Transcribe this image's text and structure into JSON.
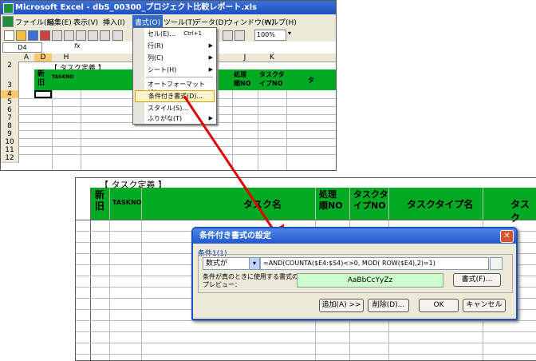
{
  "top_window": {
    "title": "Microsoft Excel - dbS_00300_プロジェクト比較レポート.xls",
    "menu": [
      "ファイル(F)",
      "編集(E)",
      "表示(V)",
      "挿入(I)",
      "書式(O)",
      "ツール(T)",
      "データ(D)",
      "ウィンドウ(W)",
      "ヘルプ(H)"
    ],
    "zoom": "100%",
    "name_box": "D4",
    "fx": "fx",
    "columns": [
      "A",
      "D",
      "H",
      "J",
      "K"
    ],
    "rows": [
      "2",
      "3",
      "4",
      "5",
      "6",
      "7",
      "8",
      "9",
      "10",
      "11",
      "12"
    ],
    "header_task_def": "【 タスク定義 】",
    "header_new": "新\n旧",
    "header_taskno": "TASKNO",
    "header_proc": "処理\n順NO",
    "header_tasktype": "タスクタ\nイプNO",
    "header_last": "タ"
  },
  "format_menu": {
    "items": [
      {
        "label": "セル(E)...",
        "shortcut": "Ctrl+1",
        "sub": false
      },
      {
        "label": "行(R)",
        "shortcut": "",
        "sub": true
      },
      {
        "label": "列(C)",
        "shortcut": "",
        "sub": true
      },
      {
        "label": "シート(H)",
        "shortcut": "",
        "sub": true
      },
      {
        "label": "オートフォーマット(A)...",
        "shortcut": "",
        "sub": false
      },
      {
        "label": "条件付き書式(D)...",
        "shortcut": "",
        "sub": false
      },
      {
        "label": "スタイル(S)...",
        "shortcut": "",
        "sub": false
      },
      {
        "label": "ふりがな(T)",
        "shortcut": "",
        "sub": true
      }
    ]
  },
  "sheet2": {
    "task_def": "【 タスク定義 】",
    "new": "新\n旧",
    "taskno": "TASKNO",
    "task_name": "タスク名",
    "proc": "処理\n順NO",
    "tasktype_no": "タスクタ\nイプNO",
    "tasktype_name": "タスクタイプ名",
    "last": "タスク"
  },
  "dialog": {
    "title": "条件付き書式の設定",
    "condition_label": "条件1(1)",
    "type_value": "数式が",
    "formula": "=AND(COUNTA($E4:$S4)<>0, MOD( ROW($E4),2)=1)",
    "preview_label": "条件が真のときに使用する書式のプレビュー：",
    "preview_text": "AaBbCcYyZz",
    "format_btn": "書式(F)...",
    "add_btn": "追加(A) >>",
    "delete_btn": "削除(D)...",
    "ok_btn": "OK",
    "cancel_btn": "キャンセル"
  },
  "colors": {
    "header_green": "#00aa22",
    "preview_green": "#ccffcc",
    "arrow_red": "#e00000",
    "title_blue": "#2358cf"
  }
}
